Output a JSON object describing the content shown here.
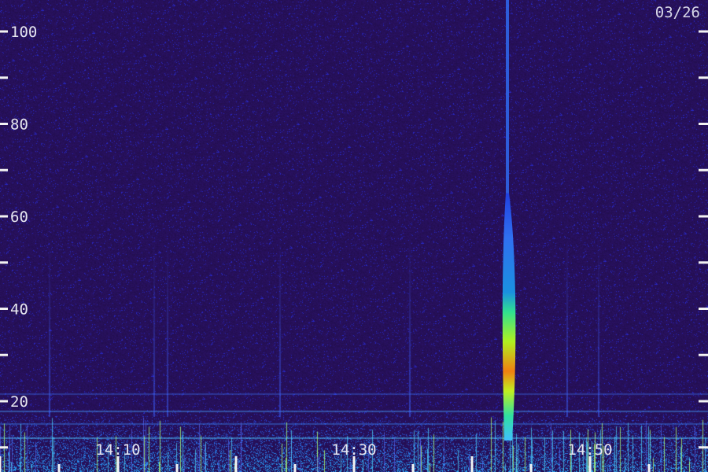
{
  "chart_data": {
    "type": "heatmap",
    "title": "",
    "date_label": "03/26",
    "xlabel": "",
    "ylabel": "",
    "y_ticks": [
      {
        "value": 100,
        "label": "100"
      },
      {
        "value": 80,
        "label": "80"
      },
      {
        "value": 60,
        "label": "60"
      },
      {
        "value": 40,
        "label": "40"
      },
      {
        "value": 20,
        "label": "20"
      }
    ],
    "y_minor_ticks": [
      90,
      70,
      50,
      30,
      10
    ],
    "ylim": [
      0,
      102
    ],
    "x_ticks": [
      {
        "value": "14:10",
        "label": "14:10"
      },
      {
        "value": "14:30",
        "label": "14:30"
      },
      {
        "value": "14:50",
        "label": "14:50"
      }
    ],
    "xlim": [
      "13:59",
      "14:59"
    ],
    "events": [
      {
        "time": "14:43",
        "freq_low": 0,
        "freq_high": 102,
        "peak_freq": 28,
        "label": ""
      }
    ],
    "colormap": [
      "#1e0f45",
      "#2b1a8a",
      "#2030d0",
      "#1aa0e0",
      "#20e0b0",
      "#a0f020",
      "#f0c010",
      "#ff4020"
    ],
    "grid": false
  }
}
